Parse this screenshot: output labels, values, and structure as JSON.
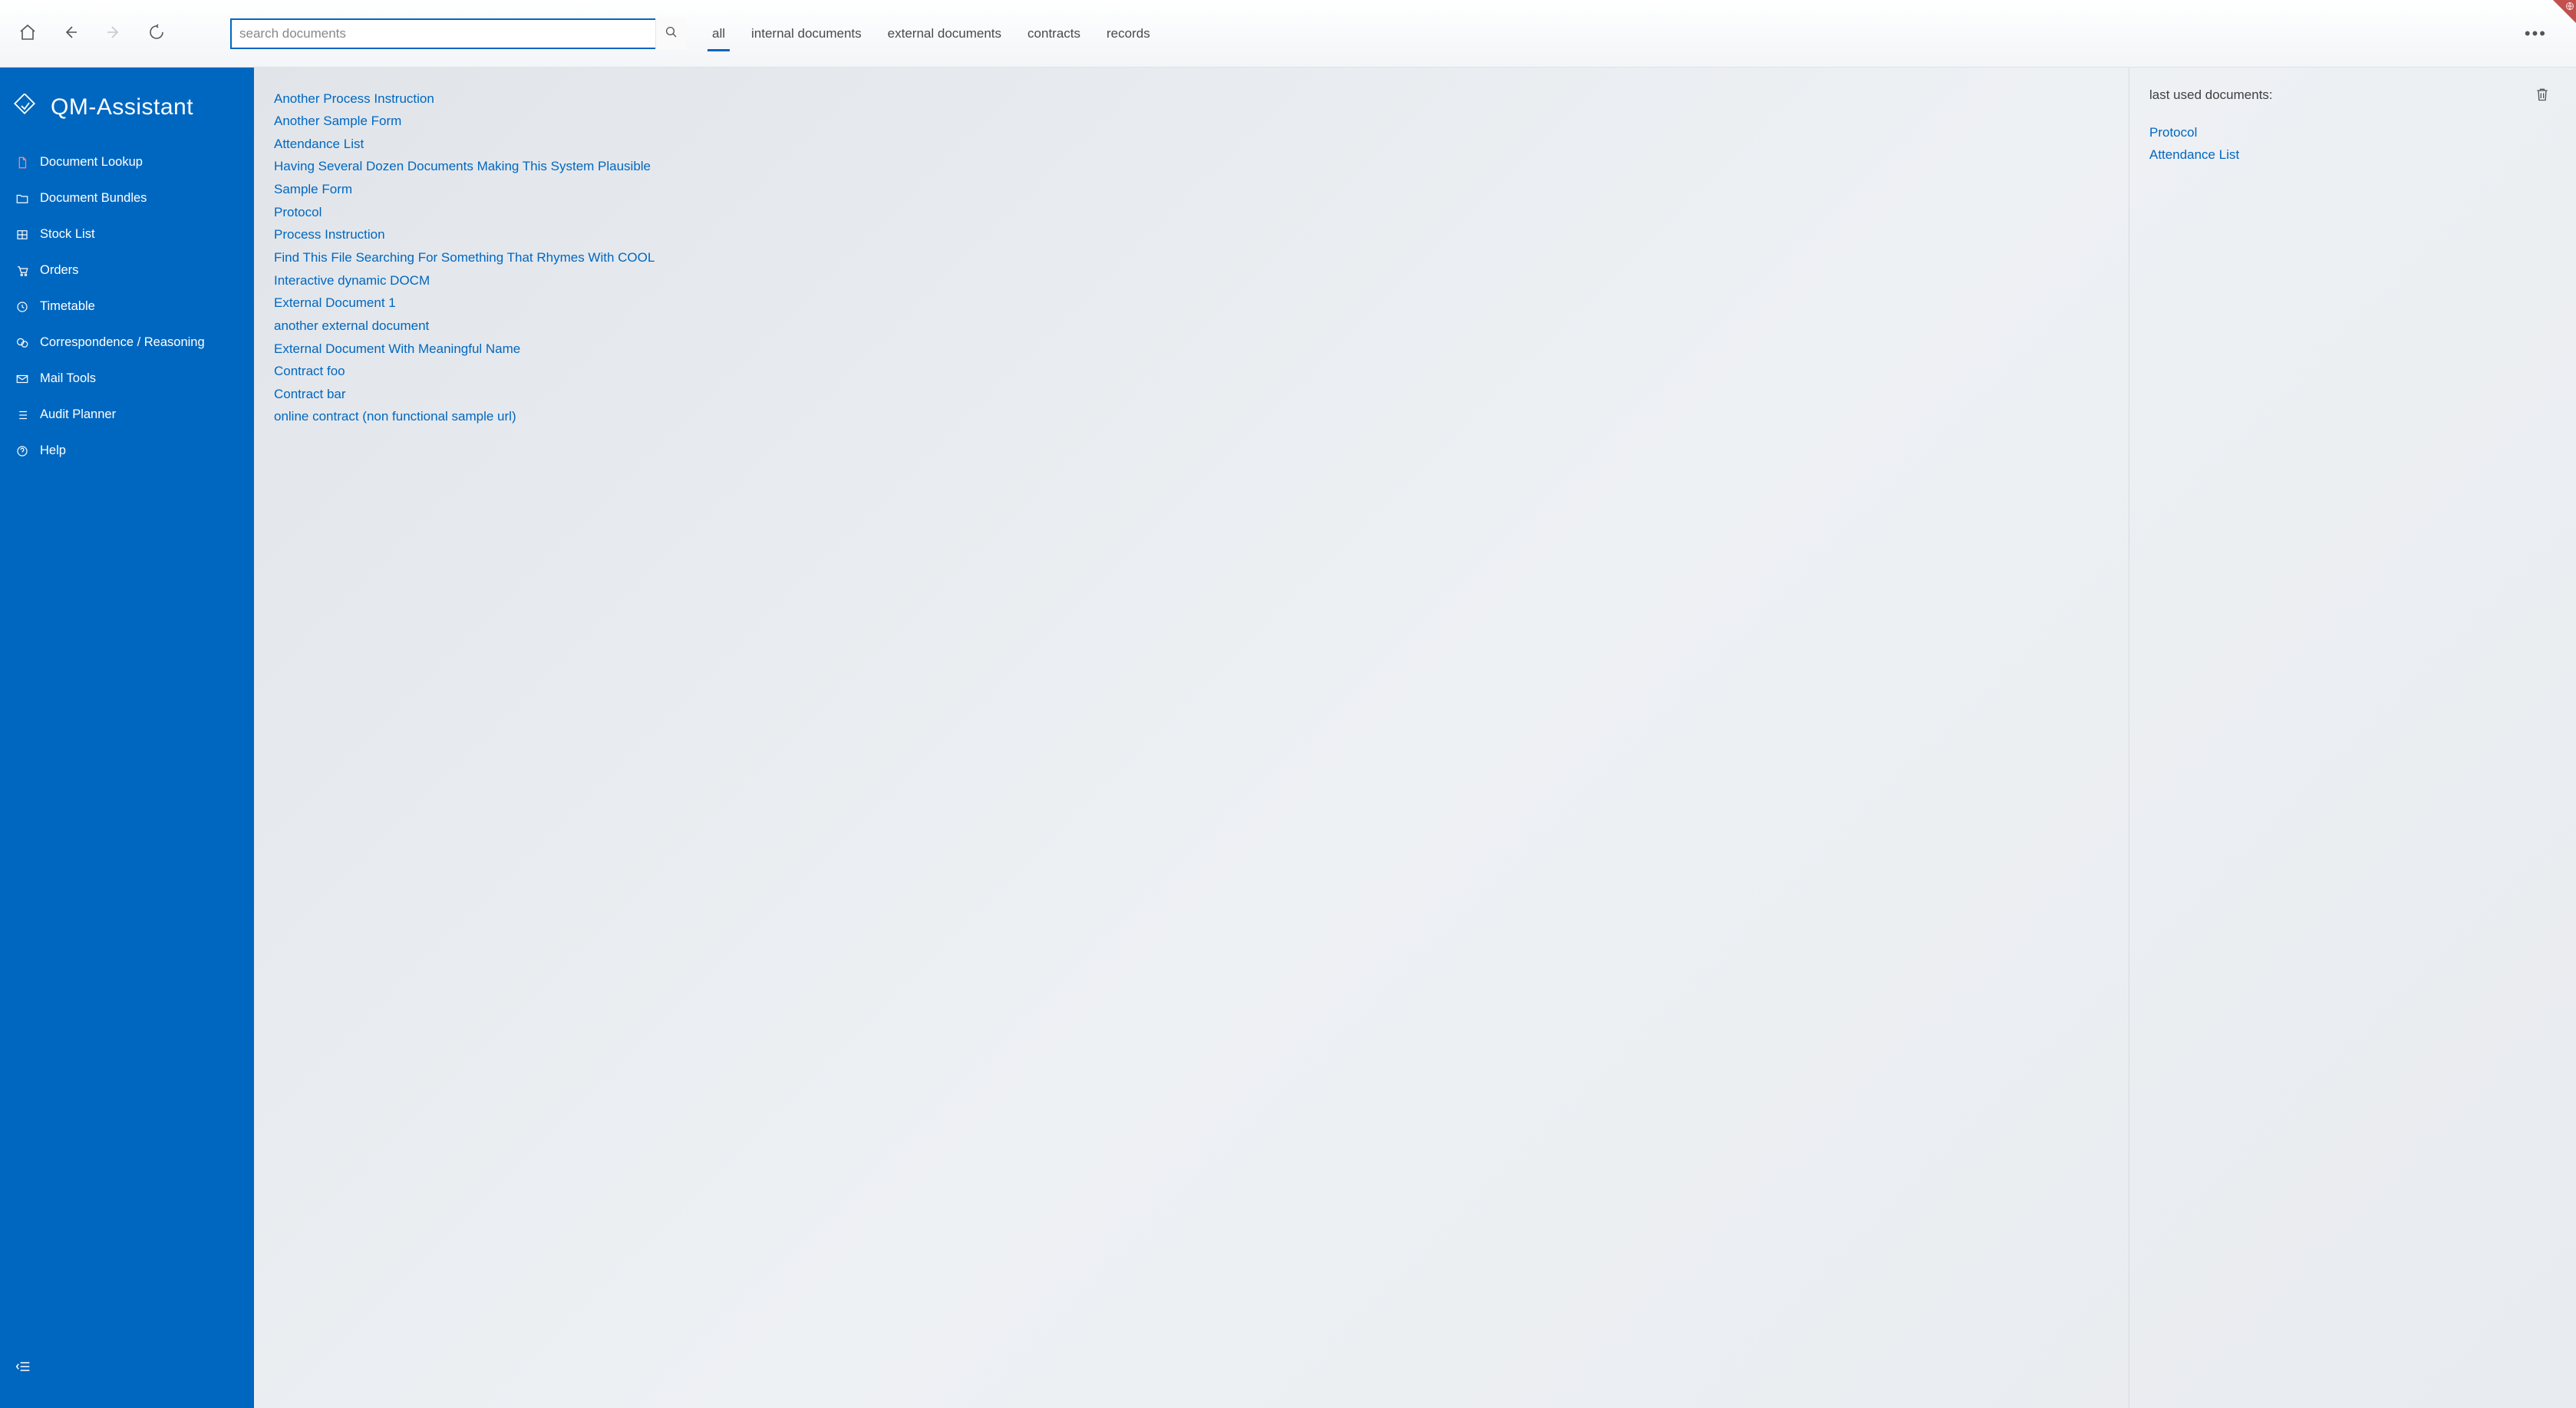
{
  "toolbar": {
    "search_placeholder": "search documents",
    "tabs": [
      {
        "id": "all",
        "label": "all",
        "active": true
      },
      {
        "id": "internal",
        "label": "internal documents",
        "active": false
      },
      {
        "id": "external",
        "label": "external documents",
        "active": false
      },
      {
        "id": "contracts",
        "label": "contracts",
        "active": false
      },
      {
        "id": "records",
        "label": "records",
        "active": false
      }
    ]
  },
  "sidebar": {
    "app_title": "QM-Assistant",
    "items": [
      {
        "id": "lookup",
        "label": "Document Lookup",
        "icon": "file",
        "active": true
      },
      {
        "id": "bundles",
        "label": "Document Bundles",
        "icon": "folder",
        "active": false
      },
      {
        "id": "stock",
        "label": "Stock List",
        "icon": "grid",
        "active": false
      },
      {
        "id": "orders",
        "label": "Orders",
        "icon": "cart",
        "active": false
      },
      {
        "id": "timetable",
        "label": "Timetable",
        "icon": "clock",
        "active": false
      },
      {
        "id": "corr",
        "label": "Correspondence / Reasoning",
        "icon": "chat",
        "active": false
      },
      {
        "id": "mail",
        "label": "Mail Tools",
        "icon": "mail",
        "active": false
      },
      {
        "id": "audit",
        "label": "Audit Planner",
        "icon": "list",
        "active": false
      },
      {
        "id": "help",
        "label": "Help",
        "icon": "help",
        "active": false
      }
    ]
  },
  "documents": [
    "Another Process Instruction",
    "Another Sample Form",
    "Attendance List",
    "Having Several Dozen Documents Making This System Plausible",
    "Sample Form",
    "Protocol",
    "Process Instruction",
    "Find This File Searching For Something That Rhymes With COOL",
    "Interactive dynamic DOCM",
    "External Document 1",
    "another external document",
    "External Document With Meaningful Name",
    "Contract foo",
    "Contract bar",
    "online contract (non functional sample url)"
  ],
  "recent_panel": {
    "title": "last used documents:",
    "items": [
      "Protocol",
      "Attendance List"
    ]
  }
}
